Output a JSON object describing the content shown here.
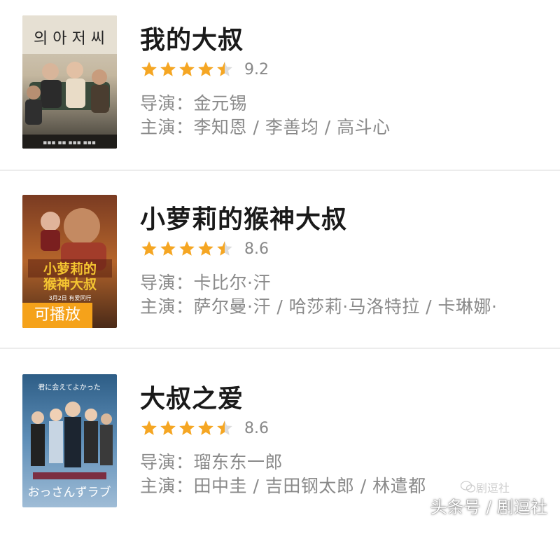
{
  "items": [
    {
      "title": "我的大叔",
      "rating": 9.2,
      "rating_text": "9.2",
      "stars": 4.5,
      "director_label": "导演：",
      "director": "金元锡",
      "cast_label": "主演：",
      "cast": "李知恩 / 李善均 / 高斗心",
      "poster_icon": "tv-drama-poster",
      "play_badge": ""
    },
    {
      "title": "小萝莉的猴神大叔",
      "rating": 8.6,
      "rating_text": "8.6",
      "stars": 4.5,
      "director_label": "导演：",
      "director": "卡比尔·汗",
      "cast_label": "主演：",
      "cast": "萨尔曼·汗 / 哈莎莉·马洛特拉 / 卡琳娜·",
      "poster_icon": "movie-poster",
      "poster_text_1": "小萝莉的",
      "poster_text_2": "猴神大叔",
      "poster_text_3": "3月2日 有爱同行",
      "play_badge": "可播放"
    },
    {
      "title": "大叔之爱",
      "rating": 8.6,
      "rating_text": "8.6",
      "stars": 4.5,
      "director_label": "导演：",
      "director": "瑠东东一郎",
      "cast_label": "主演：",
      "cast": "田中圭 / 吉田钢太郎 / 林遣都",
      "poster_icon": "tv-drama-poster",
      "poster_text_1": "君に会えてよかった",
      "poster_text_2": "おっさんずラブ",
      "play_badge": ""
    }
  ],
  "watermark": {
    "text": "头条号 / 剧逗社",
    "wechat_text": "剧逗社"
  },
  "colors": {
    "star": "#f5a623",
    "star_empty": "#dcdcdc",
    "title": "#1a1a1a",
    "meta": "#8a8a8a",
    "badge": "#f5a21a"
  }
}
